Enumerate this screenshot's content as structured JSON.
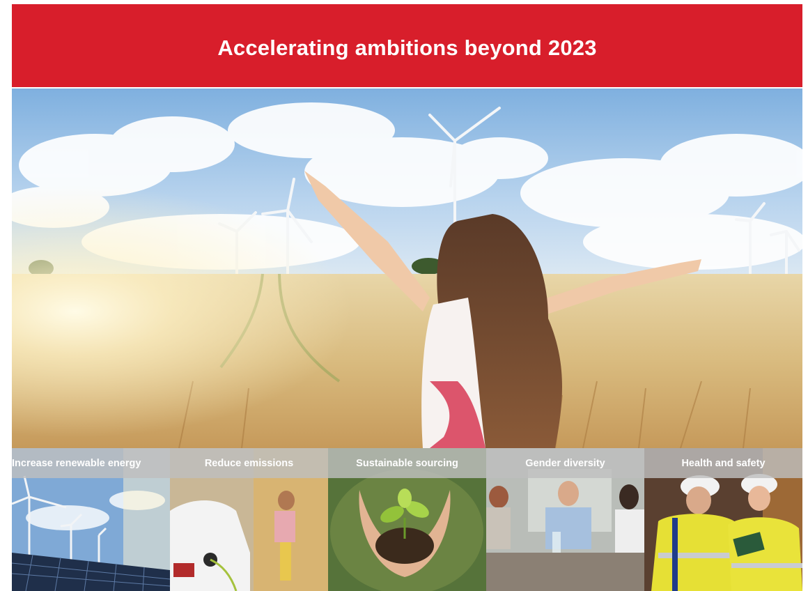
{
  "banner": {
    "title": "Accelerating ambitions beyond 2023",
    "color": "#D81E2B"
  },
  "hero": {
    "image": "girl-in-wheat-field-with-wind-turbines"
  },
  "tiles": [
    {
      "label": "Increase renewable energy",
      "image": "wind-turbines-and-solar-panels"
    },
    {
      "label": "Reduce emissions",
      "image": "electric-car-charging"
    },
    {
      "label": "Sustainable sourcing",
      "image": "hands-holding-seedling"
    },
    {
      "label": "Gender diversity",
      "image": "office-meeting"
    },
    {
      "label": "Health and safety",
      "image": "workers-in-hard-hats"
    }
  ]
}
